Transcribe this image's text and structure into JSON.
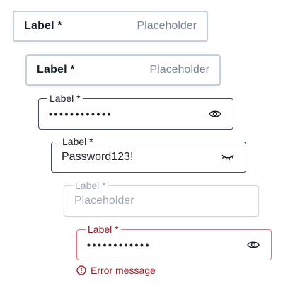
{
  "fields": [
    {
      "variant": "inline",
      "label": "Label *",
      "placeholder": "Placeholder"
    },
    {
      "variant": "inline",
      "label": "Label *",
      "placeholder": "Placeholder"
    },
    {
      "variant": "password-hidden",
      "label": "Label *",
      "value": "••••••••••••",
      "icon": "eye-icon"
    },
    {
      "variant": "password-visible",
      "label": "Label *",
      "value": "Password123!",
      "icon": "eye-closed-icon"
    },
    {
      "variant": "disabled",
      "label": "Label *",
      "placeholder": "Placeholder"
    },
    {
      "variant": "password-error",
      "label": "Label *",
      "value": "••••••••••••",
      "icon": "eye-icon",
      "error": "Error message",
      "error_icon": "error-circle-icon"
    }
  ],
  "colors": {
    "border_default": "#c7cfdb",
    "border_focus": "#3d4a66",
    "border_error": "#d9757b",
    "text_primary": "#1b1f27",
    "text_placeholder": "#7d8594",
    "text_disabled": "#a3a9b4",
    "error": "#a3202c"
  }
}
